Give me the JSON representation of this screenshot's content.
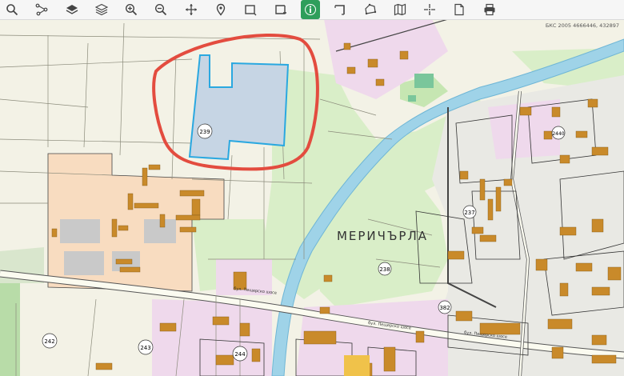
{
  "toolbar": {
    "tools": [
      {
        "icon": "search-icon"
      },
      {
        "icon": "network-icon"
      },
      {
        "icon": "layer-icon"
      },
      {
        "icon": "layers-stack-icon"
      },
      {
        "icon": "zoom-in-icon"
      },
      {
        "icon": "zoom-out-icon"
      },
      {
        "icon": "pan-icon"
      },
      {
        "icon": "location-pin-icon"
      },
      {
        "icon": "select-rectangle-icon"
      },
      {
        "icon": "select-rectangle-minus-icon"
      },
      {
        "icon": "info-icon",
        "active": true
      },
      {
        "icon": "measure-corner-icon"
      },
      {
        "icon": "polygon-draw-icon"
      },
      {
        "icon": "map-sheet-icon"
      },
      {
        "icon": "crosshair-icon"
      },
      {
        "icon": "document-icon"
      },
      {
        "icon": "print-icon"
      }
    ],
    "active_color": "#2e9e5b"
  },
  "map": {
    "coordinate_readout": "БКС 2005 4666446, 432897",
    "district_label": "МЕРИЧЪРЛА",
    "parcel_numbers": [
      "239",
      "237",
      "238",
      "382",
      "242",
      "243",
      "244",
      "2440"
    ],
    "street_labels": [
      "бул. Пещерско шосе",
      "бул. Пещерско шосе",
      "бул. Пещерско шосе"
    ],
    "colors": {
      "farmland": "#f3f2e6",
      "green": "#d9eec8",
      "industrial": "#f8dcc0",
      "residential": "#efd9ec",
      "building": "#c98a2a",
      "highlight_parcel": "#c6d5e4",
      "highlight_border": "#2aa8e0",
      "river": "#9fd3e8",
      "road": "#fbfbf0",
      "annotation": "#e34c3f"
    }
  }
}
